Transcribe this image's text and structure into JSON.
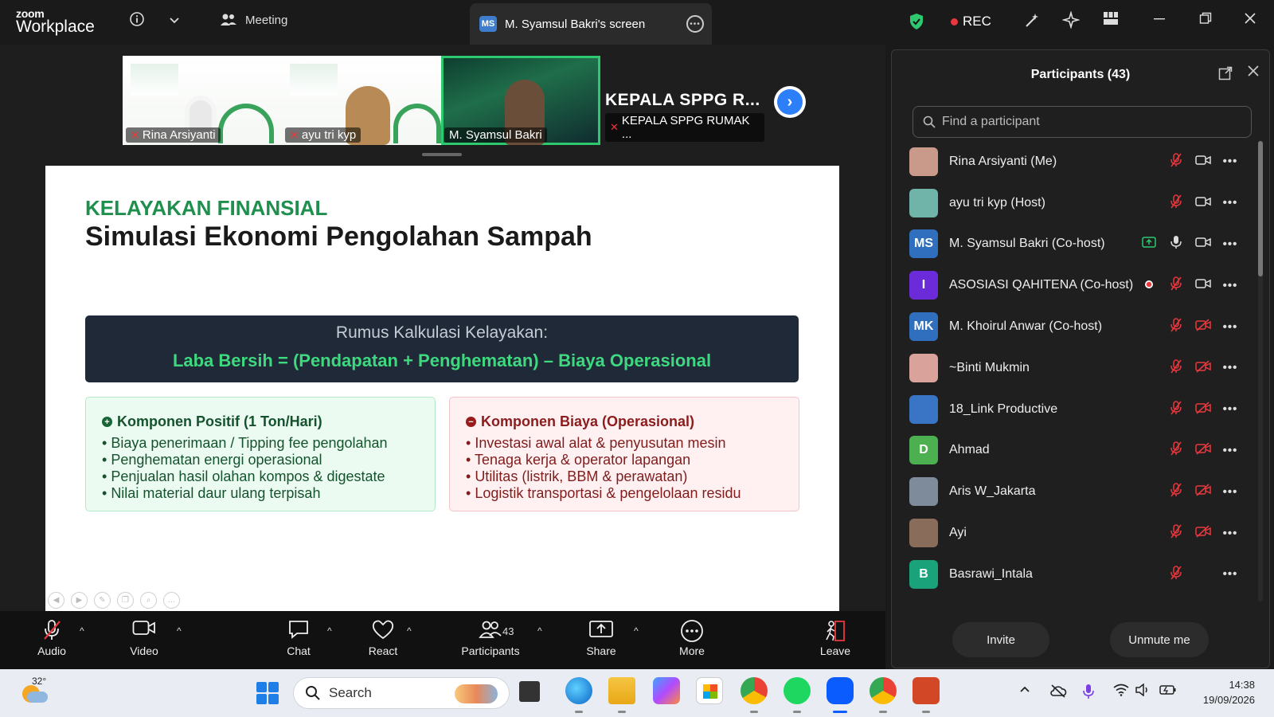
{
  "app": {
    "logo_line1": "zoom",
    "logo_line2": "Workplace"
  },
  "tabs": {
    "meeting": "Meeting",
    "screen": "M. Syamsul Bakri's screen",
    "screen_badge": "MS"
  },
  "status": {
    "rec": "REC"
  },
  "thumbnails": [
    {
      "name": "Rina Arsiyanti",
      "muted": true
    },
    {
      "name": "ayu tri kyp",
      "muted": true
    },
    {
      "name": "M. Syamsul Bakri",
      "muted": false
    },
    {
      "name": "KEPALA SPPG RUMAK ...",
      "muted": true,
      "big_label": "KEPALA SPPG R..."
    }
  ],
  "slide": {
    "kicker": "KELAYAKAN FINANSIAL",
    "title": "Simulasi Ekonomi Pengolahan Sampah",
    "formula_caption": "Rumus Kalkulasi Kelayakan:",
    "formula": "Laba Bersih = (Pendapatan + Penghematan) – Biaya Operasional",
    "positive": {
      "heading": "Komponen Positif (1 Ton/Hari)",
      "items": [
        "Biaya penerimaan / Tipping fee pengolahan",
        "Penghematan energi operasional",
        "Penjualan hasil olahan kompos & digestate",
        "Nilai material daur ulang terpisah"
      ]
    },
    "cost": {
      "heading": "Komponen Biaya (Operasional)",
      "items": [
        "Investasi awal alat & penyusutan mesin",
        "Tenaga kerja & operator lapangan",
        "Utilitas (listrik, BBM & perawatan)",
        "Logistik transportasi & pengelolaan residu"
      ]
    }
  },
  "participants": {
    "title": "Participants (43)",
    "search_placeholder": "Find a participant",
    "list": [
      {
        "name": "Rina Arsiyanti (Me)",
        "avatar": "",
        "color": "#c99a8a",
        "mic": "off",
        "video": "on"
      },
      {
        "name": "ayu tri kyp (Host)",
        "avatar": "",
        "color": "#6fb3a9",
        "mic": "off",
        "video": "on"
      },
      {
        "name": "M. Syamsul Bakri (Co-host)",
        "avatar": "MS",
        "color": "#2f6fbd",
        "mic": "on",
        "video": "on",
        "sharing": true
      },
      {
        "name": "ASOSIASI QAHITENA (Co-host)",
        "avatar": "I",
        "color": "#6c2bd9",
        "mic": "off",
        "video": "on",
        "recording": true
      },
      {
        "name": "M. Khoirul Anwar (Co-host)",
        "avatar": "MK",
        "color": "#2f6fbd",
        "mic": "off",
        "video": "off"
      },
      {
        "name": "~Binti Mukmin",
        "avatar": "",
        "color": "#d9a39b",
        "mic": "off",
        "video": "off"
      },
      {
        "name": "18_Link Productive",
        "avatar": "",
        "color": "#3a74c4",
        "mic": "off",
        "video": "off"
      },
      {
        "name": "Ahmad",
        "avatar": "D",
        "color": "#4caf50",
        "mic": "off",
        "video": "off"
      },
      {
        "name": "Aris W_Jakarta",
        "avatar": "",
        "color": "#7d8b9a",
        "mic": "off",
        "video": "off"
      },
      {
        "name": "Ayi",
        "avatar": "",
        "color": "#8a6c5a",
        "mic": "off",
        "video": "off"
      },
      {
        "name": "Basrawi_Intala",
        "avatar": "B",
        "color": "#1aa37a",
        "mic": "off",
        "video": "none"
      }
    ],
    "invite": "Invite",
    "unmute": "Unmute me"
  },
  "toolbar": {
    "audio": "Audio",
    "video": "Video",
    "chat": "Chat",
    "react": "React",
    "participants": "Participants",
    "participants_count": "43",
    "share": "Share",
    "more": "More",
    "leave": "Leave"
  },
  "taskbar": {
    "temp": "32°",
    "search": "Search",
    "time": "14:38",
    "date": "19/09/2026"
  }
}
